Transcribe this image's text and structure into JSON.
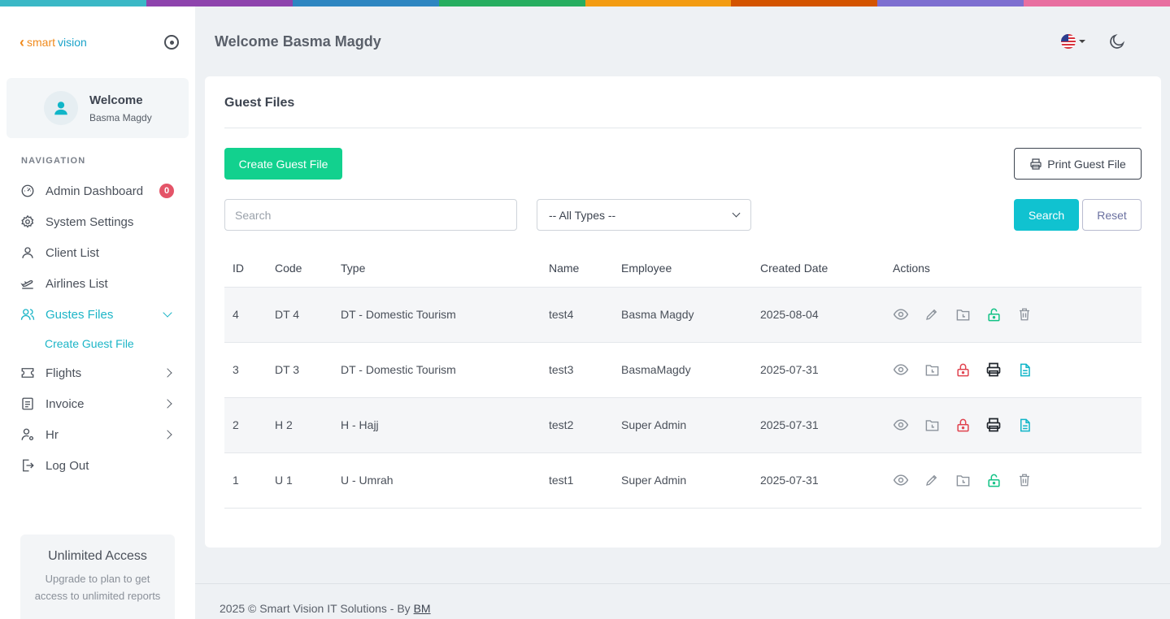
{
  "stripe_colors": [
    "#3bb8c6",
    "#8e44ad",
    "#2e86c1",
    "#27ae60",
    "#f39c12",
    "#d35400",
    "#7d6fd0",
    "#e86fa0"
  ],
  "sidebar": {
    "logo": {
      "smart": "smart",
      "vision": "vision"
    },
    "welcome": {
      "title": "Welcome",
      "name": "Basma Magdy"
    },
    "nav_label": "NAVIGATION",
    "items": [
      {
        "label": "Admin Dashboard",
        "icon": "dashboard-icon",
        "badge": "0"
      },
      {
        "label": "System Settings",
        "icon": "gear-icon"
      },
      {
        "label": "Client List",
        "icon": "user-icon"
      },
      {
        "label": "Airlines List",
        "icon": "plane-icon"
      },
      {
        "label": "Gustes Files",
        "icon": "users-icon",
        "active": true
      },
      {
        "label": "Flights",
        "icon": "ticket-icon"
      },
      {
        "label": "Invoice",
        "icon": "invoice-icon"
      },
      {
        "label": "Hr",
        "icon": "user-gear-icon"
      },
      {
        "label": "Log Out",
        "icon": "logout-icon"
      }
    ],
    "sub_item": "Create Guest File",
    "upgrade": {
      "title": "Unlimited Access",
      "text": "Upgrade to plan to get access to unlimited reports"
    }
  },
  "header": {
    "title": "Welcome Basma Magdy"
  },
  "card": {
    "title": "Guest Files",
    "create_label": "Create Guest File",
    "print_label": "Print Guest File",
    "search_placeholder": "Search",
    "type_select": "-- All Types --",
    "search_label": "Search",
    "reset_label": "Reset"
  },
  "table": {
    "columns": [
      "ID",
      "Code",
      "Type",
      "Name",
      "Employee",
      "Created Date",
      "Actions"
    ],
    "rows": [
      {
        "id": "4",
        "code": "DT 4",
        "type": "DT - Domestic Tourism",
        "name": "test4",
        "employee": "Basma Magdy",
        "date": "2025-08-04",
        "actions": [
          "view",
          "edit",
          "folder",
          "unlock",
          "delete"
        ]
      },
      {
        "id": "3",
        "code": "DT 3",
        "type": "DT - Domestic Tourism",
        "name": "test3",
        "employee": "BasmaMagdy",
        "date": "2025-07-31",
        "actions": [
          "view",
          "folder",
          "lock",
          "print",
          "doc"
        ]
      },
      {
        "id": "2",
        "code": "H 2",
        "type": "H - Hajj",
        "name": "test2",
        "employee": "Super Admin",
        "date": "2025-07-31",
        "actions": [
          "view",
          "folder",
          "lock",
          "print",
          "doc"
        ]
      },
      {
        "id": "1",
        "code": "U 1",
        "type": "U - Umrah",
        "name": "test1",
        "employee": "Super Admin",
        "date": "2025-07-31",
        "actions": [
          "view",
          "edit",
          "folder",
          "unlock",
          "delete"
        ]
      }
    ]
  },
  "footer": {
    "text": "2025 © Smart Vision IT Solutions - By ",
    "link": "BM"
  }
}
